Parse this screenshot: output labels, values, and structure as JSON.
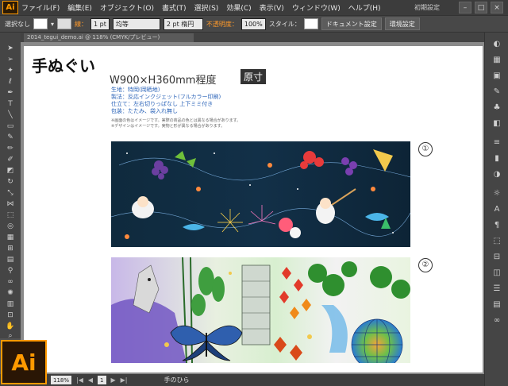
{
  "app": {
    "logo": "Ai"
  },
  "menu": [
    "ファイル(F)",
    "編集(E)",
    "オブジェクト(O)",
    "書式(T)",
    "選択(S)",
    "効果(C)",
    "表示(V)",
    "ウィンドウ(W)",
    "ヘルプ(H)"
  ],
  "workspace": "初期設定",
  "control": {
    "selection": "選択なし",
    "stroke_label": "線：",
    "stroke_weight": "1 pt",
    "brush": "均等",
    "brush_size": "2 pt 楕円",
    "opacity_label": "不透明度：",
    "opacity": "100%",
    "style_label": "スタイル：",
    "doc_settings": "ドキュメント設定",
    "prefs": "環境設定"
  },
  "document": {
    "tab": "2014_tegui_demo.ai @ 118% (CMYK/プレビュー)"
  },
  "artboard": {
    "title": "手ぬぐい",
    "size": "W900×H360mm程度",
    "size_badge": "原寸",
    "specs": [
      "生地：特岡(岡晒地)",
      "製法：反応インクジェット(フルカラー印刷)",
      "仕立て：左右切りっぱなし 上下ミミ付き",
      "包装：たたみ、袋入れ無し"
    ],
    "notes": [
      "※画面の色はイメージです。実際の商品の色とは異なる場合があります。",
      "※デザインはイメージです。実物と形が異なる場合があります。"
    ],
    "designs": [
      {
        "number": "①"
      },
      {
        "number": "②"
      }
    ]
  },
  "status": {
    "zoom": "118%",
    "page": "1",
    "tool": "手のひら"
  }
}
